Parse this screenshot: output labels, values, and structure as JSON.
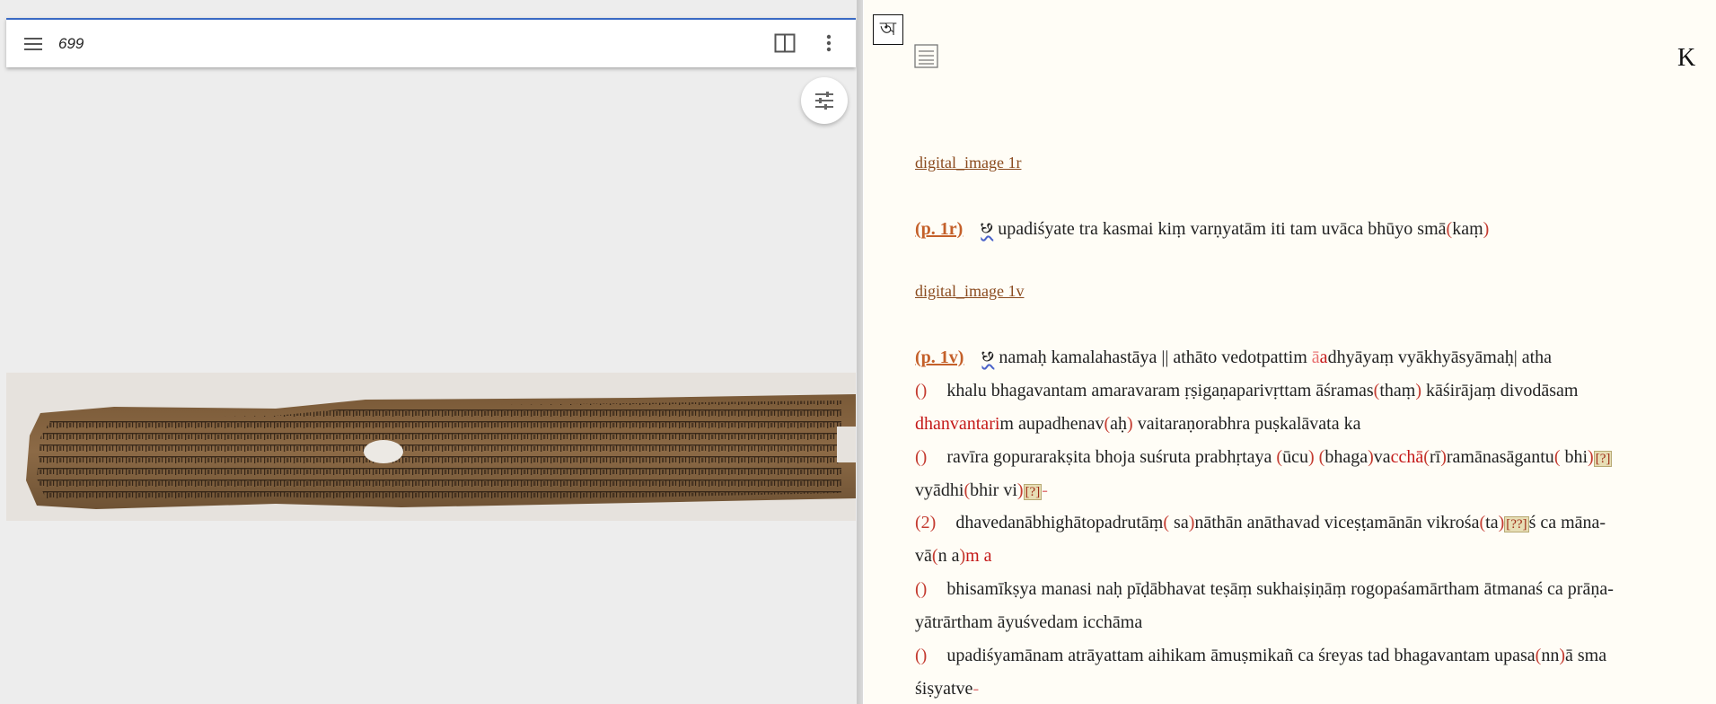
{
  "viewer": {
    "folio": "699",
    "menu_icon": "hamburger-menu-icon",
    "layout_icon": "two-page-layout-icon",
    "more_icon": "more-vertical-icon",
    "settings_icon": "sliders-icon",
    "manuscript_image": "palm-leaf-manuscript"
  },
  "text_pane": {
    "script_toggle_glyph": "অ",
    "list_icon": "list-icon",
    "corner_label": "K",
    "image_link_1r": "digital_image 1r",
    "image_link_1v": "digital_image 1v",
    "page_ref_1r": "(p. 1r)",
    "page_ref_1v": "(p. 1v)",
    "line_1r": {
      "siglum": "꣸",
      "text_a": "upadiśyate tra kasmai kiṃ varṇyatām iti tam uvāca bhūyo smā",
      "bracket_open": "(",
      "text_b": "kaṃ",
      "bracket_close": ")"
    },
    "line_1v_1": {
      "siglum": "꣸",
      "text_a": "namaḥ kamalahastāya || athāto vedotpattim ",
      "deleted": "ā",
      "inserted": "a",
      "text_b": "dhyāyaṃ vyākhyāsyāmaḥ| atha"
    },
    "line_2": {
      "num": "()",
      "text_a": "khalu bhagavantam amaravaram ṛṣigaṇaparivṛttam āśramas",
      "bracket_open": "(",
      "text_b": "thaṃ",
      "bracket_close": ")",
      "text_c": " kāśirājaṃ divodāsam"
    },
    "line_3": {
      "red": "dhanvantari",
      "text_a": "m aupadhenav",
      "bracket_open": "(",
      "text_b": "aḥ",
      "bracket_close": ")",
      "text_c": " vaitaraṇorabhra puṣkalāvata ka"
    },
    "line_4": {
      "num": "()",
      "text_a": "ravīra gopurarakṣita bhoja suśruta prabhṛtaya ",
      "p1o": "(",
      "t1": "ūcu",
      "p1c": ")",
      "sp": " ",
      "p2o": "(",
      "t2": "bhaga",
      "p2c": ")",
      "t3": "va",
      "red": "cchā",
      "p3o": "(",
      "t4": "rī",
      "p3c": ")",
      "t5": "ramānasāgantu",
      "p4o": "(",
      "t6": " bhi",
      "p4c": ")",
      "q": "[?]"
    },
    "line_5": {
      "text_a": "vyādhi",
      "p1o": "(",
      "t1": "bhir vi",
      "p1c": ")",
      "q": "[?]",
      "brk": "-"
    },
    "line_6": {
      "num": "(2)",
      "text_a": "dhavedanābhighātopadrutāṃ",
      "p1o": "(",
      "t1": " sa",
      "p1c": ")",
      "t2": "nāthān anāthavad viceṣṭamānān vikrośa",
      "p2o": "(",
      "t3": "ta",
      "p2c": ")",
      "q": "[??]",
      "t4": "ś ca māna-"
    },
    "line_7": {
      "text_a": "vā",
      "p1o": "(",
      "t1": "n a",
      "p1c": ")",
      "red": "m a"
    },
    "line_8": {
      "num": "()",
      "text_a": "bhisamīkṣya manasi naḥ pīḍābhavat teṣāṃ sukhaiṣiṇāṃ rogopaśamārtham ātmanaś ca prāṇa-"
    },
    "line_9": {
      "text_a": "yātrārtham āyuśvedam icchāma"
    },
    "line_10": {
      "num": "()",
      "text_a": "upadiśyamānam atrāyattam aihikam āmuṣmikañ ca śreyas tad bhagavantam upasa",
      "p1o": "(",
      "t1": "nn",
      "p1c": ")",
      "text_b": "ā sma"
    },
    "line_11": {
      "text_a": "śiṣyatve",
      "brk": "-"
    }
  }
}
